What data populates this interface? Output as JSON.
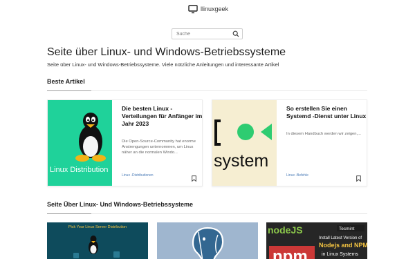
{
  "header": {
    "site_name": "llinuxgeek"
  },
  "search": {
    "placeholder": "Suche"
  },
  "hero": {
    "title": "Seite über Linux- und Windows-Betriebssysteme",
    "description": "Seite über Linux- und Windows-Betriebssysteme. Viele nützliche Anleitungen und interessante Artikel"
  },
  "best": {
    "heading": "Beste Artikel",
    "articles": [
      {
        "title": "Die besten Linux -Verteilungen für Anfänger im Jahr 2023",
        "excerpt": "Die Open-Source-Community hat enorme Anstrengungen unternommen, um Linux näher an die normalen Windo...",
        "category": "Linux -Distributionen",
        "image_caption": "Linux Distribution"
      },
      {
        "title": "So erstellen Sie einen Systemd -Dienst unter Linux",
        "excerpt": "In diesem Handbuch werden wir zeigen,...",
        "category": "Linux -Befehle",
        "image_caption": "system"
      }
    ]
  },
  "latest": {
    "heading": "Seite Über Linux- Und Windows-Betriebssysteme",
    "thumbs": [
      {
        "caption": "Pick Your Linux Server Distribution"
      },
      {
        "caption": ""
      },
      {
        "logo_text": "nodeJS",
        "badge_text": "Tecmint",
        "line1": "Install Latest Version of",
        "line2": "Nodejs and NPM",
        "line3": "in Linux Systems",
        "npm_text": "npm"
      }
    ]
  },
  "colors": {
    "accent_link": "#4a7bb7",
    "card1_bg": "#1fd29a",
    "card2_bg": "#f6eed2",
    "thumb1_bg": "#0e4b5c",
    "thumb2_bg": "#9fb6cf",
    "thumb3_bg": "#262626"
  },
  "icons": {
    "logo": "monitor-icon",
    "search": "search-icon",
    "bookmark": "bookmark-icon"
  }
}
